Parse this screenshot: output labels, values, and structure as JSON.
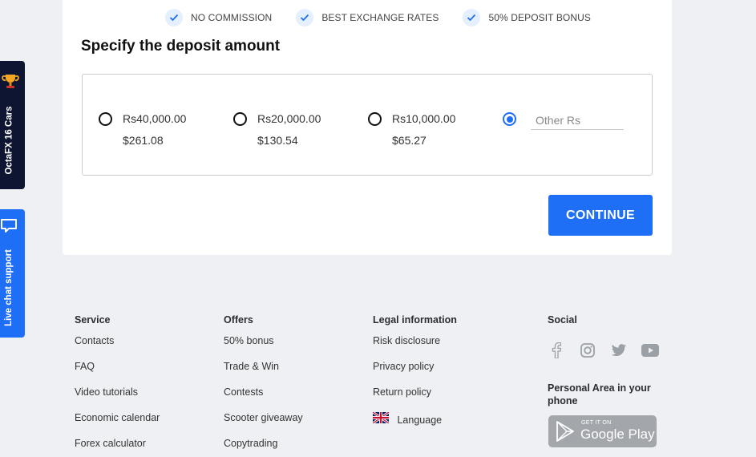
{
  "features": [
    {
      "icon": "check-icon",
      "label": "NO COMMISSION"
    },
    {
      "icon": "check-icon",
      "label": "BEST EXCHANGE RATES"
    },
    {
      "icon": "check-icon",
      "label": "50% DEPOSIT BONUS"
    }
  ],
  "deposit": {
    "title": "Specify the deposit amount",
    "options": [
      {
        "amount": "Rs40,000.00",
        "usd": "$261.08",
        "selected": false
      },
      {
        "amount": "Rs20,000.00",
        "usd": "$130.54",
        "selected": false
      },
      {
        "amount": "Rs10,000.00",
        "usd": "$65.27",
        "selected": false
      }
    ],
    "other": {
      "placeholder": "Other Rs",
      "value": "",
      "selected": true
    },
    "continue_label": "CONTINUE"
  },
  "side": {
    "promo_label": "OctaFX 16 Cars",
    "chat_label": "Live chat support"
  },
  "footer": {
    "service": {
      "heading": "Service",
      "links": [
        "Contacts",
        "FAQ",
        "Video tutorials",
        "Economic calendar",
        "Forex calculator"
      ]
    },
    "offers": {
      "heading": "Offers",
      "links": [
        "50% bonus",
        "Trade & Win",
        "Contests",
        "Scooter giveaway",
        "Copytrading"
      ]
    },
    "legal": {
      "heading": "Legal information",
      "links": [
        "Risk disclosure",
        "Privacy policy",
        "Return policy"
      ],
      "language": "Language"
    },
    "social": {
      "heading": "Social",
      "icons": [
        "facebook-icon",
        "instagram-icon",
        "twitter-icon",
        "youtube-icon"
      ]
    },
    "personal_area": "Personal Area in your phone",
    "gplay": {
      "small": "GET IT ON",
      "big": "Google Play"
    }
  },
  "colors": {
    "accent": "#1e6ff5",
    "promo_bg": "#0d1533",
    "page_bg": "#eef0f3"
  }
}
